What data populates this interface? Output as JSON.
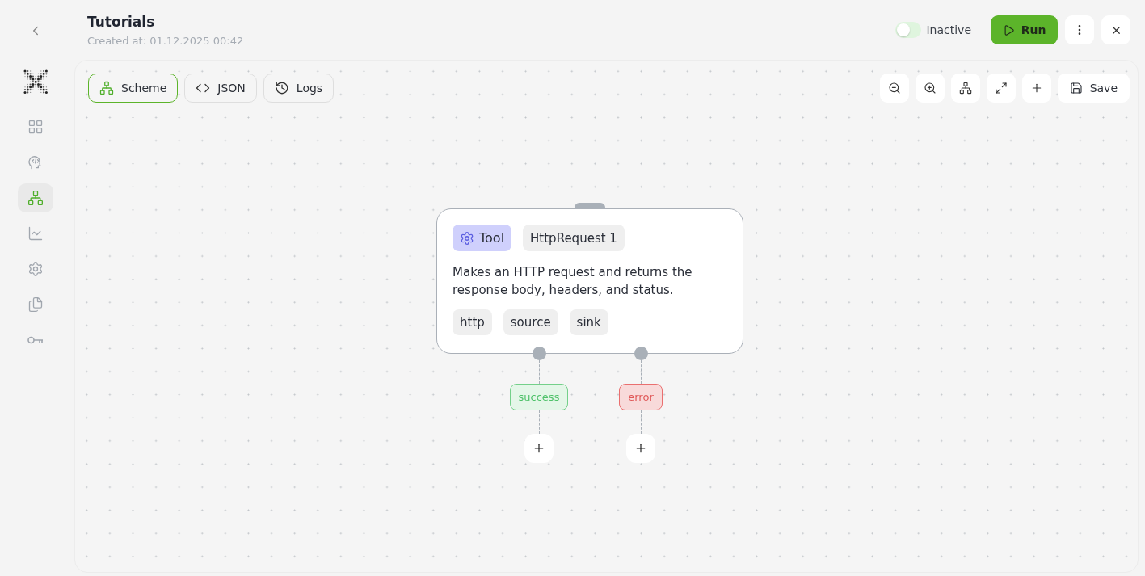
{
  "sidebar": {
    "items": [
      {
        "kind": "dashboard",
        "selected": false
      },
      {
        "kind": "head",
        "selected": false
      },
      {
        "kind": "scheme",
        "selected": true
      },
      {
        "kind": "chart",
        "selected": false
      },
      {
        "kind": "settings",
        "selected": false
      },
      {
        "kind": "files",
        "selected": false
      },
      {
        "kind": "key",
        "selected": false
      }
    ]
  },
  "header": {
    "title": "Tutorials",
    "created": "Created at: 01.12.2025 00:42",
    "status": {
      "label": "Inactive",
      "on": false
    },
    "run_button": "Run"
  },
  "tabs": [
    {
      "label": "Scheme",
      "kind": "scheme",
      "selected": true
    },
    {
      "label": "JSON",
      "kind": "code",
      "selected": false
    },
    {
      "label": "Logs",
      "kind": "history",
      "selected": false
    }
  ],
  "toolbar": {
    "tools": [
      {
        "kind": "zoom-out"
      },
      {
        "kind": "zoom-in"
      },
      {
        "kind": "layout"
      },
      {
        "kind": "expand"
      },
      {
        "kind": "add"
      }
    ],
    "save_button": "Save"
  },
  "node": {
    "type": "Tool",
    "name": "HttpRequest 1",
    "description": "Makes an HTTP request and returns the response body, headers, and status.",
    "tags": [
      "http",
      "source",
      "sink"
    ],
    "outputs": [
      {
        "label": "success",
        "kind": "success"
      },
      {
        "label": "error",
        "kind": "error"
      }
    ]
  }
}
